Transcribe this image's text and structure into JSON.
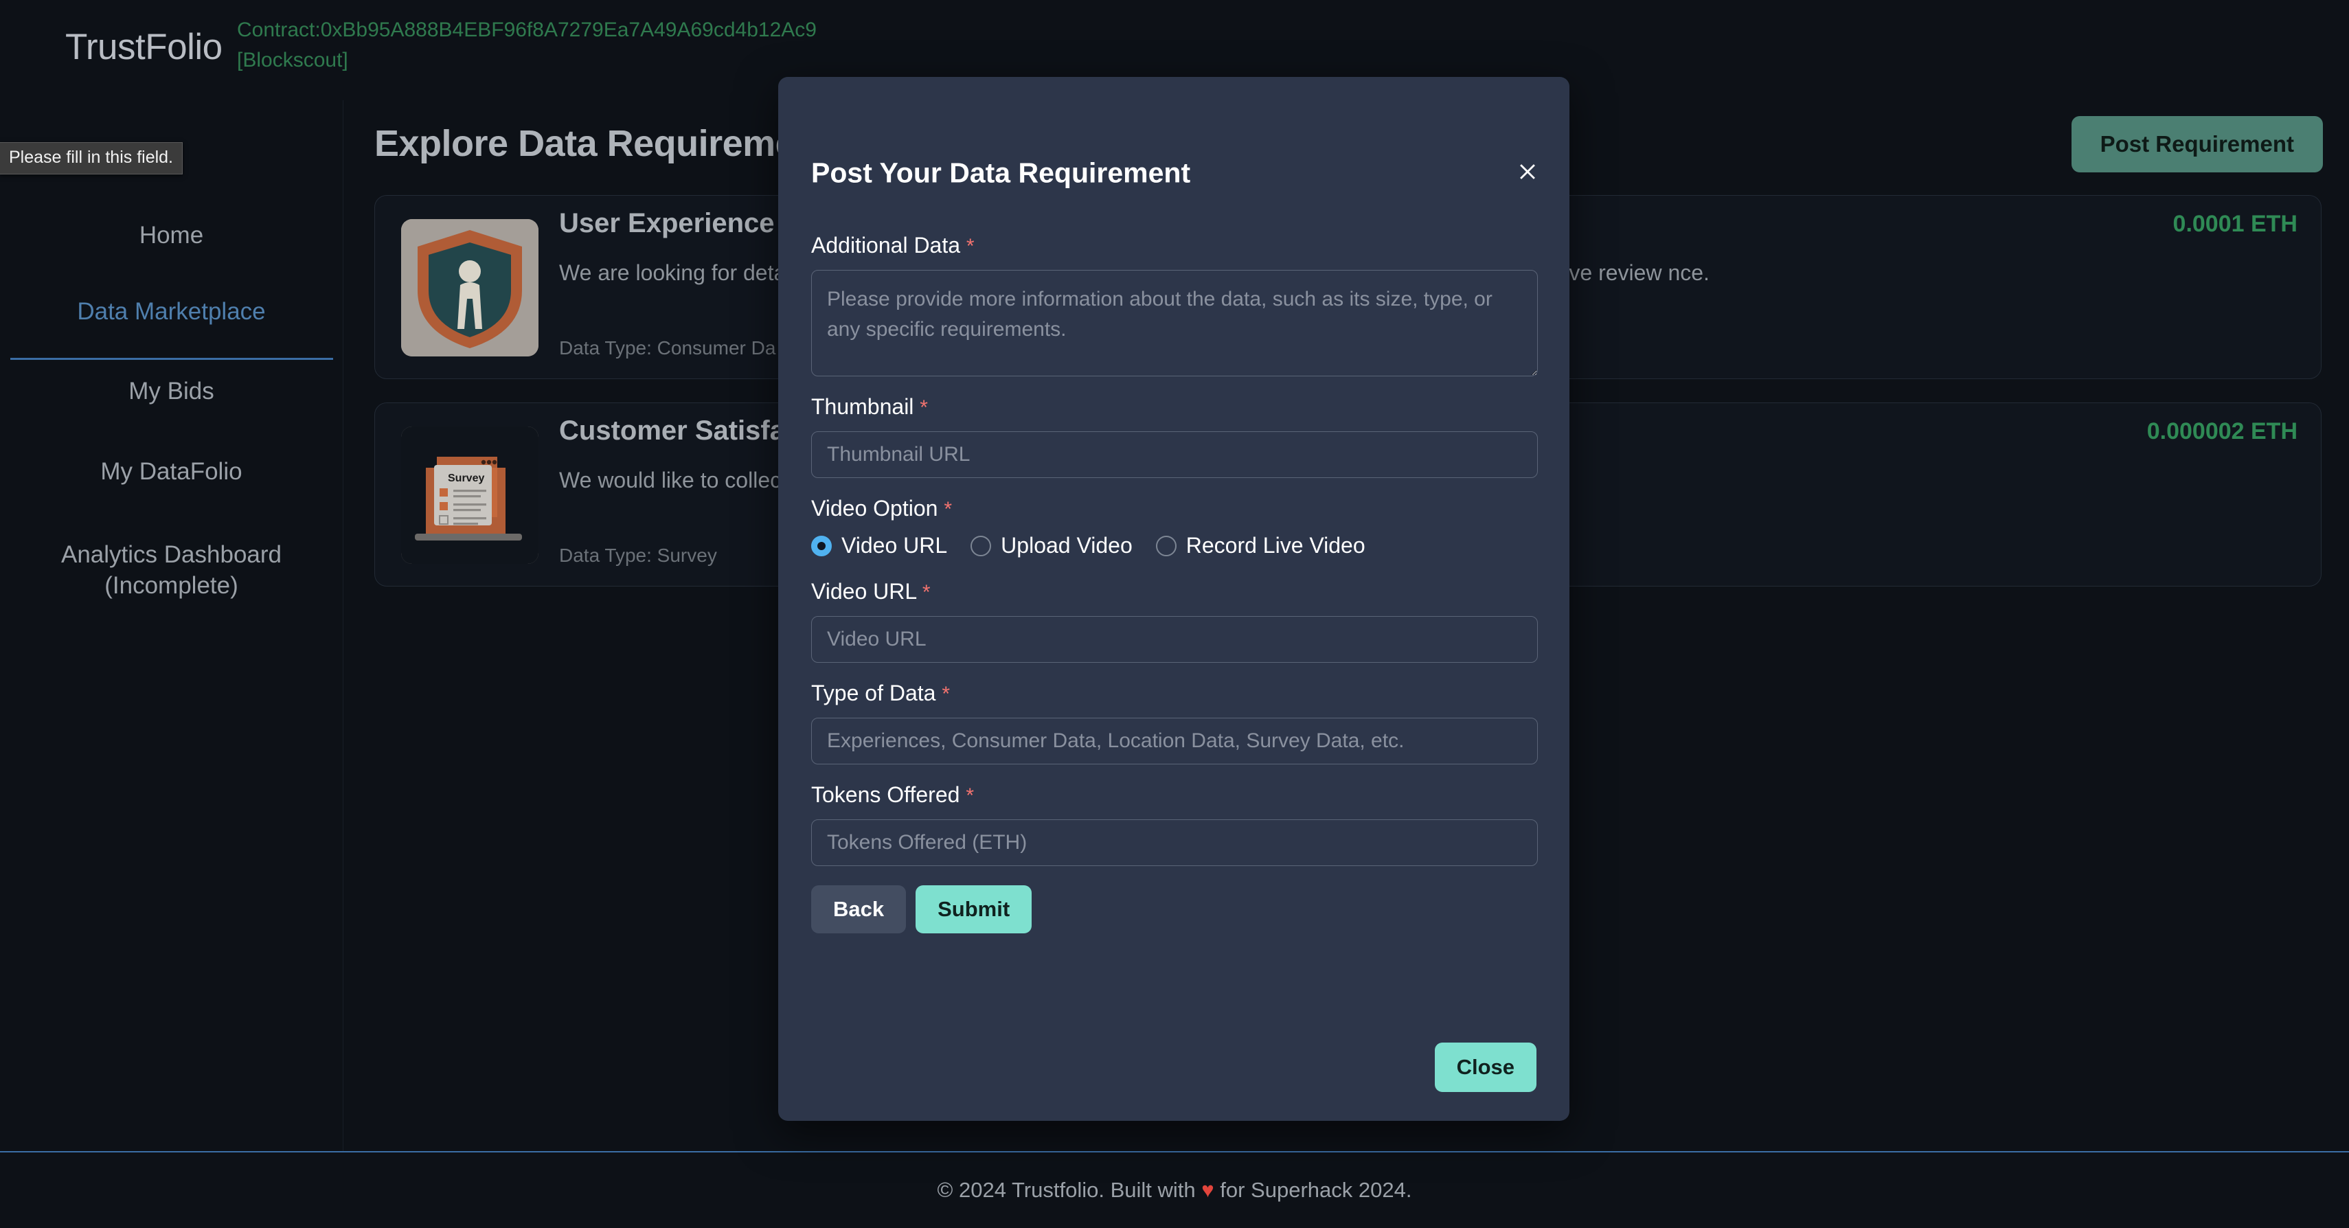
{
  "header": {
    "brand": "TrustFolio",
    "contract": "Contract:0xBb95A888B4EBF96f8A7279Ea7A49A69cd4b12Ac9",
    "blockscout": "[Blockscout]"
  },
  "tooltip": {
    "message": "Please fill in this field."
  },
  "sidebar": {
    "items": [
      {
        "label": "Home"
      },
      {
        "label": "Data Marketplace"
      },
      {
        "label": "My Bids"
      },
      {
        "label": "My DataFolio"
      },
      {
        "label": "Analytics Dashboard (Incomplete)"
      }
    ]
  },
  "main": {
    "title": "Explore Data Requirements",
    "post_requirement_label": "Post Requirement",
    "cards": [
      {
        "title": "User Experience F",
        "description": "We are looking for deta                                     rustFolio. Participants are required to use the platform and provide comprehensive review                                  nce.",
        "data_type": "Data Type: Consumer Da",
        "price": "0.0001 ETH",
        "thumbnail_icon": "shield-person-icon"
      },
      {
        "title": "Customer Satisfac",
        "description": "We would like to collec",
        "data_type": "Data Type: Survey",
        "price": "0.000002 ETH",
        "thumbnail_icon": "survey-laptop-icon"
      }
    ]
  },
  "modal": {
    "title": "Post Your Data Requirement",
    "close_icon": "close-icon",
    "fields": {
      "additional_data": {
        "label": "Additional Data",
        "required_marker": "*",
        "placeholder": "Please provide more information about the data, such as its size, type, or any specific requirements.",
        "value": ""
      },
      "thumbnail": {
        "label": "Thumbnail",
        "required_marker": "*",
        "placeholder": "Thumbnail URL",
        "value": ""
      },
      "video_option": {
        "label": "Video Option",
        "required_marker": "*",
        "options": [
          {
            "label": "Video URL",
            "selected": true
          },
          {
            "label": "Upload Video",
            "selected": false
          },
          {
            "label": "Record Live Video",
            "selected": false
          }
        ]
      },
      "video_url": {
        "label": "Video URL",
        "required_marker": "*",
        "placeholder": "Video URL",
        "value": ""
      },
      "type_of_data": {
        "label": "Type of Data",
        "required_marker": "*",
        "placeholder": "Experiences, Consumer Data, Location Data, Survey Data, etc.",
        "value": ""
      },
      "tokens_offered": {
        "label": "Tokens Offered",
        "required_marker": "*",
        "placeholder": "Tokens Offered (ETH)",
        "value": ""
      }
    },
    "buttons": {
      "back": "Back",
      "submit": "Submit",
      "close": "Close"
    }
  },
  "footer": {
    "prefix": "© 2024 Trustfolio. Built with ",
    "heart": "♥",
    "suffix": " for Superhack 2024."
  },
  "colors": {
    "page_bg": "#0d1117",
    "modal_bg": "#2d364a",
    "accent_teal": "#7ee0cf",
    "accent_blue": "#3b6ea5",
    "price_green": "#2f8a55",
    "contract_green": "#2f7a4e",
    "required_red": "#f2736f",
    "radio_selected": "#50b2f0",
    "post_btn_bg": "#4b7f72"
  }
}
